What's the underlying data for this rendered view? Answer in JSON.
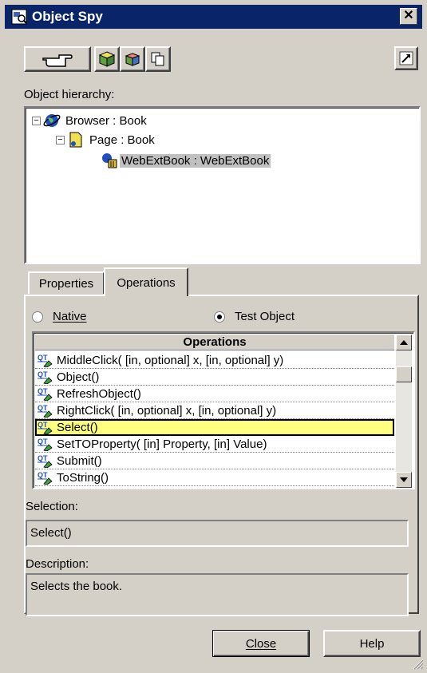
{
  "window": {
    "title": "Object Spy"
  },
  "hierarchy": {
    "label": "Object hierarchy:",
    "items": [
      {
        "text": "Browser : Book"
      },
      {
        "text": "Page : Book"
      },
      {
        "text": "WebExtBook : WebExtBook"
      }
    ]
  },
  "tabs": [
    {
      "label": "Properties"
    },
    {
      "label": "Operations"
    }
  ],
  "radios": {
    "native": "Native",
    "test_object": "Test Object",
    "selected": "Test Object"
  },
  "operations": {
    "header": "Operations",
    "items": [
      "MiddleClick( [in, optional] x, [in, optional] y)",
      "Object()",
      "RefreshObject()",
      "RightClick( [in, optional] x, [in, optional] y)",
      "Select()",
      "SetTOProperty( [in] Property, [in] Value)",
      "Submit()",
      "ToString()"
    ],
    "selected_index": 4
  },
  "selection": {
    "label": "Selection:",
    "value": "Select()"
  },
  "description": {
    "label": "Description:",
    "value": "Selects the book."
  },
  "buttons": {
    "close": "Close",
    "help": "Help"
  },
  "colors": {
    "title_bar": "#0a246a",
    "selected_row": "#ffff80",
    "dialog_bg": "#d4d0c8"
  }
}
